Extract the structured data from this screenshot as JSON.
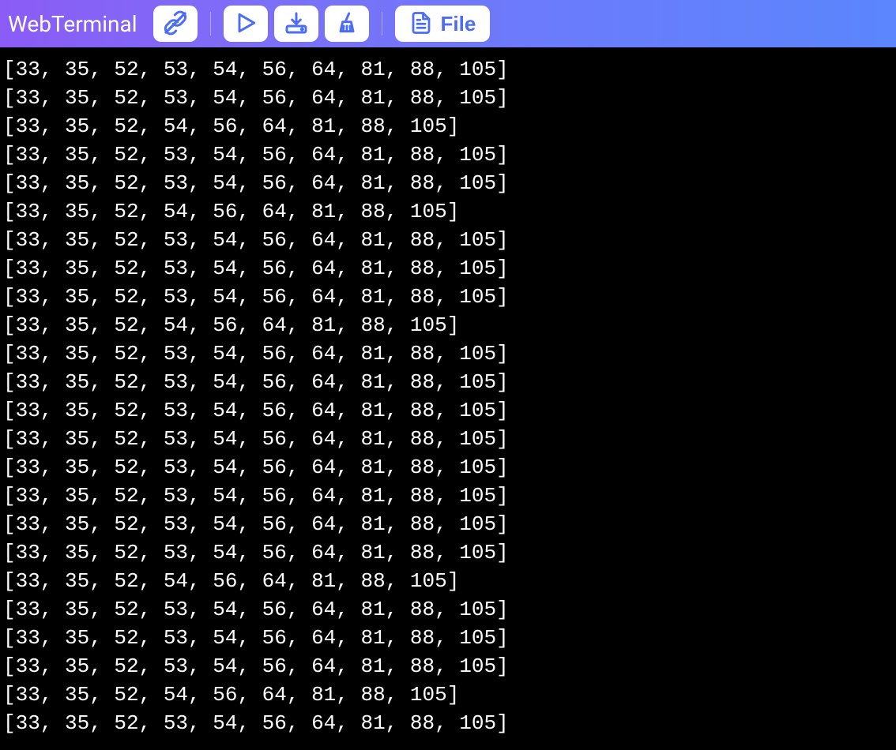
{
  "app": {
    "title": "WebTerminal"
  },
  "toolbar": {
    "file_label": "File"
  },
  "terminal": {
    "lines": [
      "[33, 35, 52, 53, 54, 56, 64, 81, 88, 105]",
      "[33, 35, 52, 53, 54, 56, 64, 81, 88, 105]",
      "[33, 35, 52, 54, 56, 64, 81, 88, 105]",
      "[33, 35, 52, 53, 54, 56, 64, 81, 88, 105]",
      "[33, 35, 52, 53, 54, 56, 64, 81, 88, 105]",
      "[33, 35, 52, 54, 56, 64, 81, 88, 105]",
      "[33, 35, 52, 53, 54, 56, 64, 81, 88, 105]",
      "[33, 35, 52, 53, 54, 56, 64, 81, 88, 105]",
      "[33, 35, 52, 53, 54, 56, 64, 81, 88, 105]",
      "[33, 35, 52, 54, 56, 64, 81, 88, 105]",
      "[33, 35, 52, 53, 54, 56, 64, 81, 88, 105]",
      "[33, 35, 52, 53, 54, 56, 64, 81, 88, 105]",
      "[33, 35, 52, 53, 54, 56, 64, 81, 88, 105]",
      "[33, 35, 52, 53, 54, 56, 64, 81, 88, 105]",
      "[33, 35, 52, 53, 54, 56, 64, 81, 88, 105]",
      "[33, 35, 52, 53, 54, 56, 64, 81, 88, 105]",
      "[33, 35, 52, 53, 54, 56, 64, 81, 88, 105]",
      "[33, 35, 52, 53, 54, 56, 64, 81, 88, 105]",
      "[33, 35, 52, 54, 56, 64, 81, 88, 105]",
      "[33, 35, 52, 53, 54, 56, 64, 81, 88, 105]",
      "[33, 35, 52, 53, 54, 56, 64, 81, 88, 105]",
      "[33, 35, 52, 53, 54, 56, 64, 81, 88, 105]",
      "[33, 35, 52, 54, 56, 64, 81, 88, 105]",
      "[33, 35, 52, 53, 54, 56, 64, 81, 88, 105]"
    ]
  }
}
